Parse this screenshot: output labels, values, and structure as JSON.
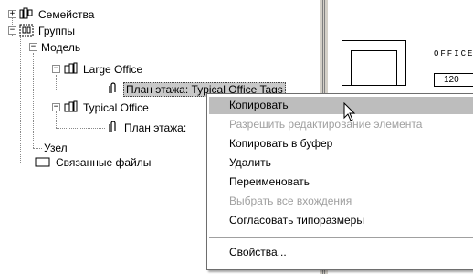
{
  "tree": {
    "families": "Семейства",
    "groups": "Группы",
    "model": "Модель",
    "large_office": "Large Office",
    "large_office_plan": "План этажа: Typical Office Tags",
    "typical_office": "Typical Office",
    "typical_office_plan": "План этажа:",
    "node": "Узел",
    "linked_files": "Связанные файлы"
  },
  "drawing": {
    "room_name": "OFFICE",
    "room_number": "120"
  },
  "context_menu": {
    "items": [
      {
        "label": "Копировать",
        "state": "highlighted"
      },
      {
        "label": "Разрешить редактирование элемента",
        "state": "disabled"
      },
      {
        "label": "Копировать в буфер",
        "state": "enabled"
      },
      {
        "label": "Удалить",
        "state": "enabled"
      },
      {
        "label": "Переименовать",
        "state": "enabled"
      },
      {
        "label": "Выбрать все вхождения",
        "state": "disabled"
      },
      {
        "label": "Согласовать типоразмеры",
        "state": "enabled"
      },
      {
        "label": "Свойства...",
        "state": "enabled"
      }
    ]
  },
  "colors": {
    "highlight": "#bdbdbd",
    "disabled_text": "#a0a0a0",
    "splitter": "#d4d0c8"
  }
}
